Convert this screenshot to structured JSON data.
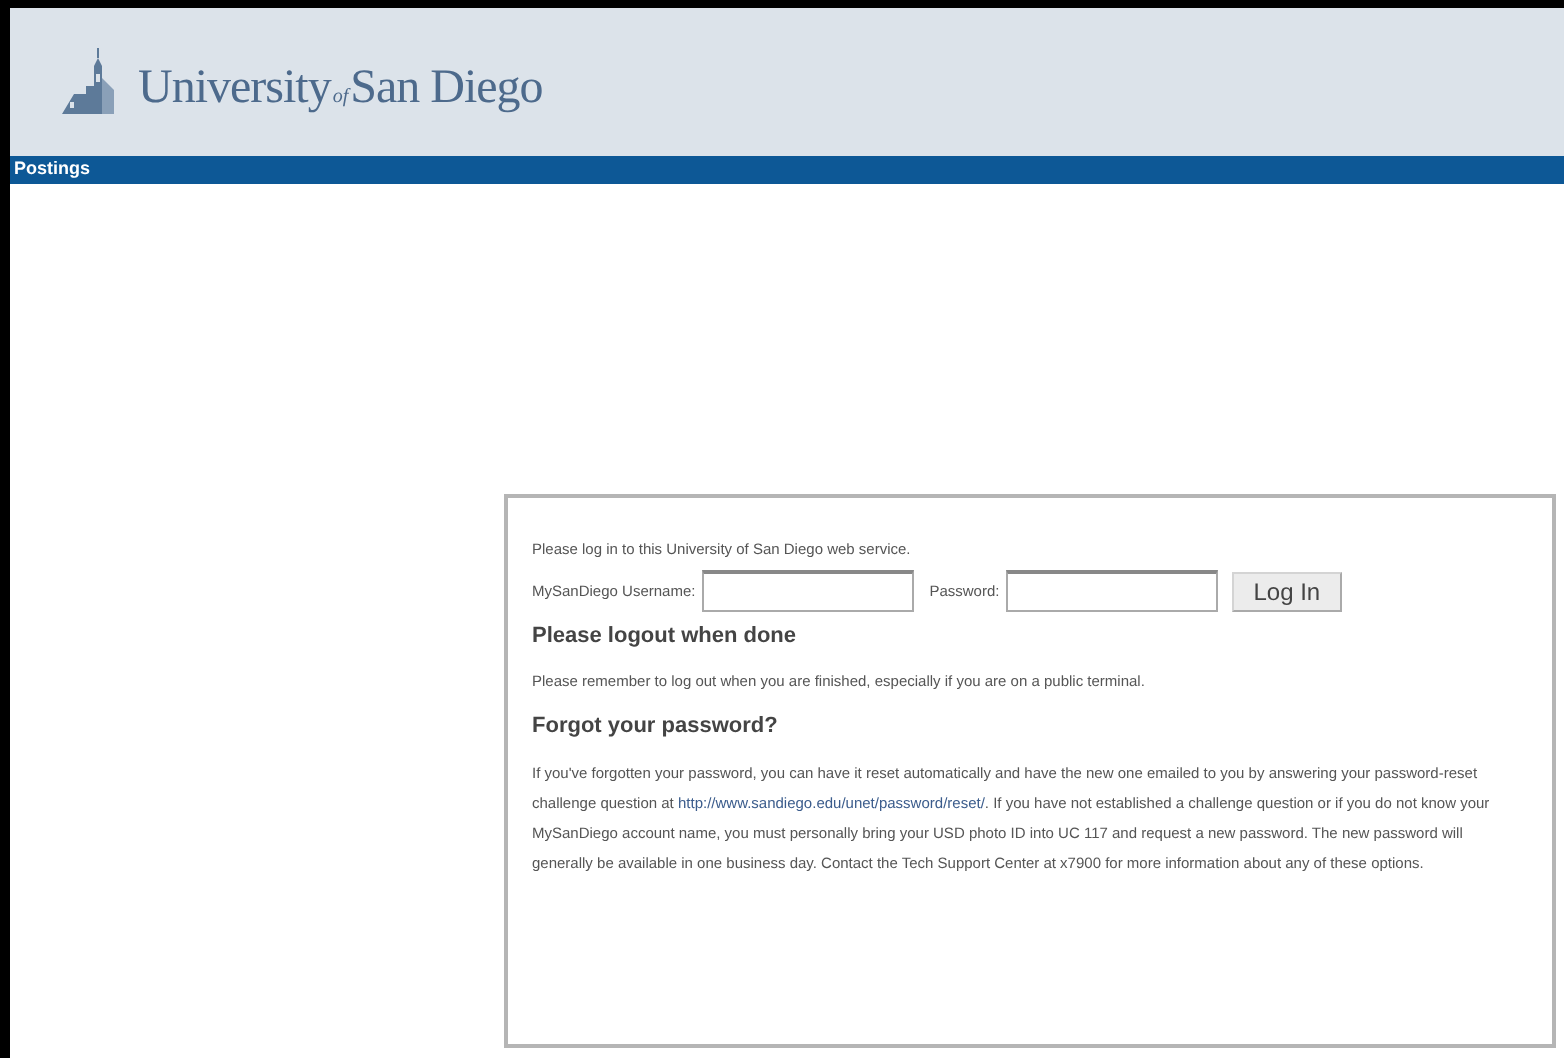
{
  "header": {
    "logo_text_1": "University",
    "logo_text_2": "of",
    "logo_text_3": "San Diego"
  },
  "nav_bar": {
    "label": "Postings"
  },
  "login": {
    "intro": "Please log in to this University of San Diego web service.",
    "username_label": "MySanDiego Username:",
    "password_label": "Password:",
    "button": "Log In",
    "logout_heading": "Please logout when done",
    "logout_text": "Please remember to log out when you are finished, especially if you are on a public terminal.",
    "forgot_heading": "Forgot your password?",
    "forgot_text_before": "If you've forgotten your password, you can have it reset automatically and have the new one emailed to you by answering your password-reset challenge question at ",
    "forgot_link": "http://www.sandiego.edu/unet/password/reset/",
    "forgot_text_after": ". If you have not established a challenge question or if you do not know your MySanDiego account name, you must personally bring your USD photo ID into UC 117 and request a new password. The new password will generally be available in one business day. Contact the Tech Support Center at x7900 for more information about any of these options."
  }
}
